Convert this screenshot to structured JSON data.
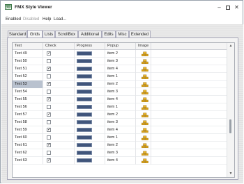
{
  "window": {
    "title": "FMX Style Viewer"
  },
  "menu": {
    "items": [
      "Enabled",
      "Disabled",
      "Help",
      "Load..."
    ]
  },
  "tabs": [
    "Standard",
    "Grids",
    "Lists",
    "ScrollBox",
    "Additional",
    "Edits",
    "Misc",
    "Extended"
  ],
  "active_tab": "Grids",
  "grid": {
    "columns": [
      "Text",
      "Check",
      "Progress",
      "Popup",
      "Image"
    ],
    "rows": [
      {
        "text": "Text 49",
        "check": true,
        "progress": 1.0,
        "popup": "item 2"
      },
      {
        "text": "Text 50",
        "check": false,
        "progress": 1.0,
        "popup": "item 3"
      },
      {
        "text": "Text 51",
        "check": true,
        "progress": 1.0,
        "popup": "item 4"
      },
      {
        "text": "Text 52",
        "check": false,
        "progress": 1.0,
        "popup": "item 1"
      },
      {
        "text": "Text 53",
        "check": true,
        "progress": 1.0,
        "popup": "item 2",
        "selected": true
      },
      {
        "text": "Text 54",
        "check": false,
        "progress": 1.0,
        "popup": "item 3"
      },
      {
        "text": "Text 55",
        "check": true,
        "progress": 1.0,
        "popup": "item 4"
      },
      {
        "text": "Text 56",
        "check": false,
        "progress": 1.0,
        "popup": "item 1"
      },
      {
        "text": "Text 57",
        "check": true,
        "progress": 1.0,
        "popup": "item 2"
      },
      {
        "text": "Text 58",
        "check": false,
        "progress": 1.0,
        "popup": "item 3"
      },
      {
        "text": "Text 59",
        "check": true,
        "progress": 1.0,
        "popup": "item 4"
      },
      {
        "text": "Text 60",
        "check": false,
        "progress": 1.0,
        "popup": "item 1"
      },
      {
        "text": "Text 61",
        "check": true,
        "progress": 1.0,
        "popup": "item 2"
      },
      {
        "text": "Text 62",
        "check": false,
        "progress": 1.0,
        "popup": "item 3"
      },
      {
        "text": "Text 63",
        "check": true,
        "progress": 1.0,
        "popup": "item 4"
      }
    ],
    "image_icon": "gold-bars-icon"
  },
  "colors": {
    "progress_fill": "#40557b",
    "selection": "#b9c2cf"
  }
}
